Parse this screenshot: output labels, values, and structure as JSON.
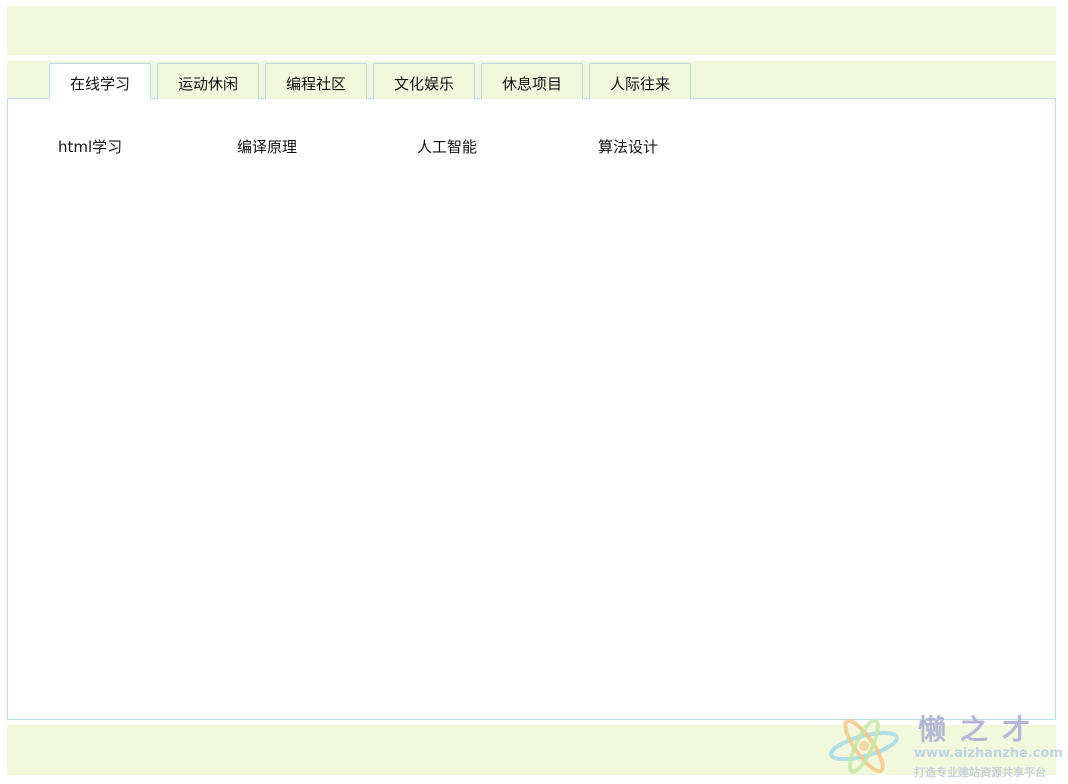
{
  "tabs": [
    {
      "label": "在线学习",
      "active": true
    },
    {
      "label": "运动休闲",
      "active": false
    },
    {
      "label": "编程社区",
      "active": false
    },
    {
      "label": "文化娱乐",
      "active": false
    },
    {
      "label": "休息项目",
      "active": false
    },
    {
      "label": "人际往来",
      "active": false
    }
  ],
  "content": {
    "links": [
      "html学习",
      "编译原理",
      "人工智能",
      "算法设计"
    ]
  },
  "watermark": {
    "title": "懒之才",
    "url": "www.aizhanzhe.com",
    "slogan": "打造专业建站资源共享平台"
  },
  "colors": {
    "bar_background": "#f1f8dc",
    "border": "#b7dde9",
    "active_tab": "#ffffff"
  }
}
